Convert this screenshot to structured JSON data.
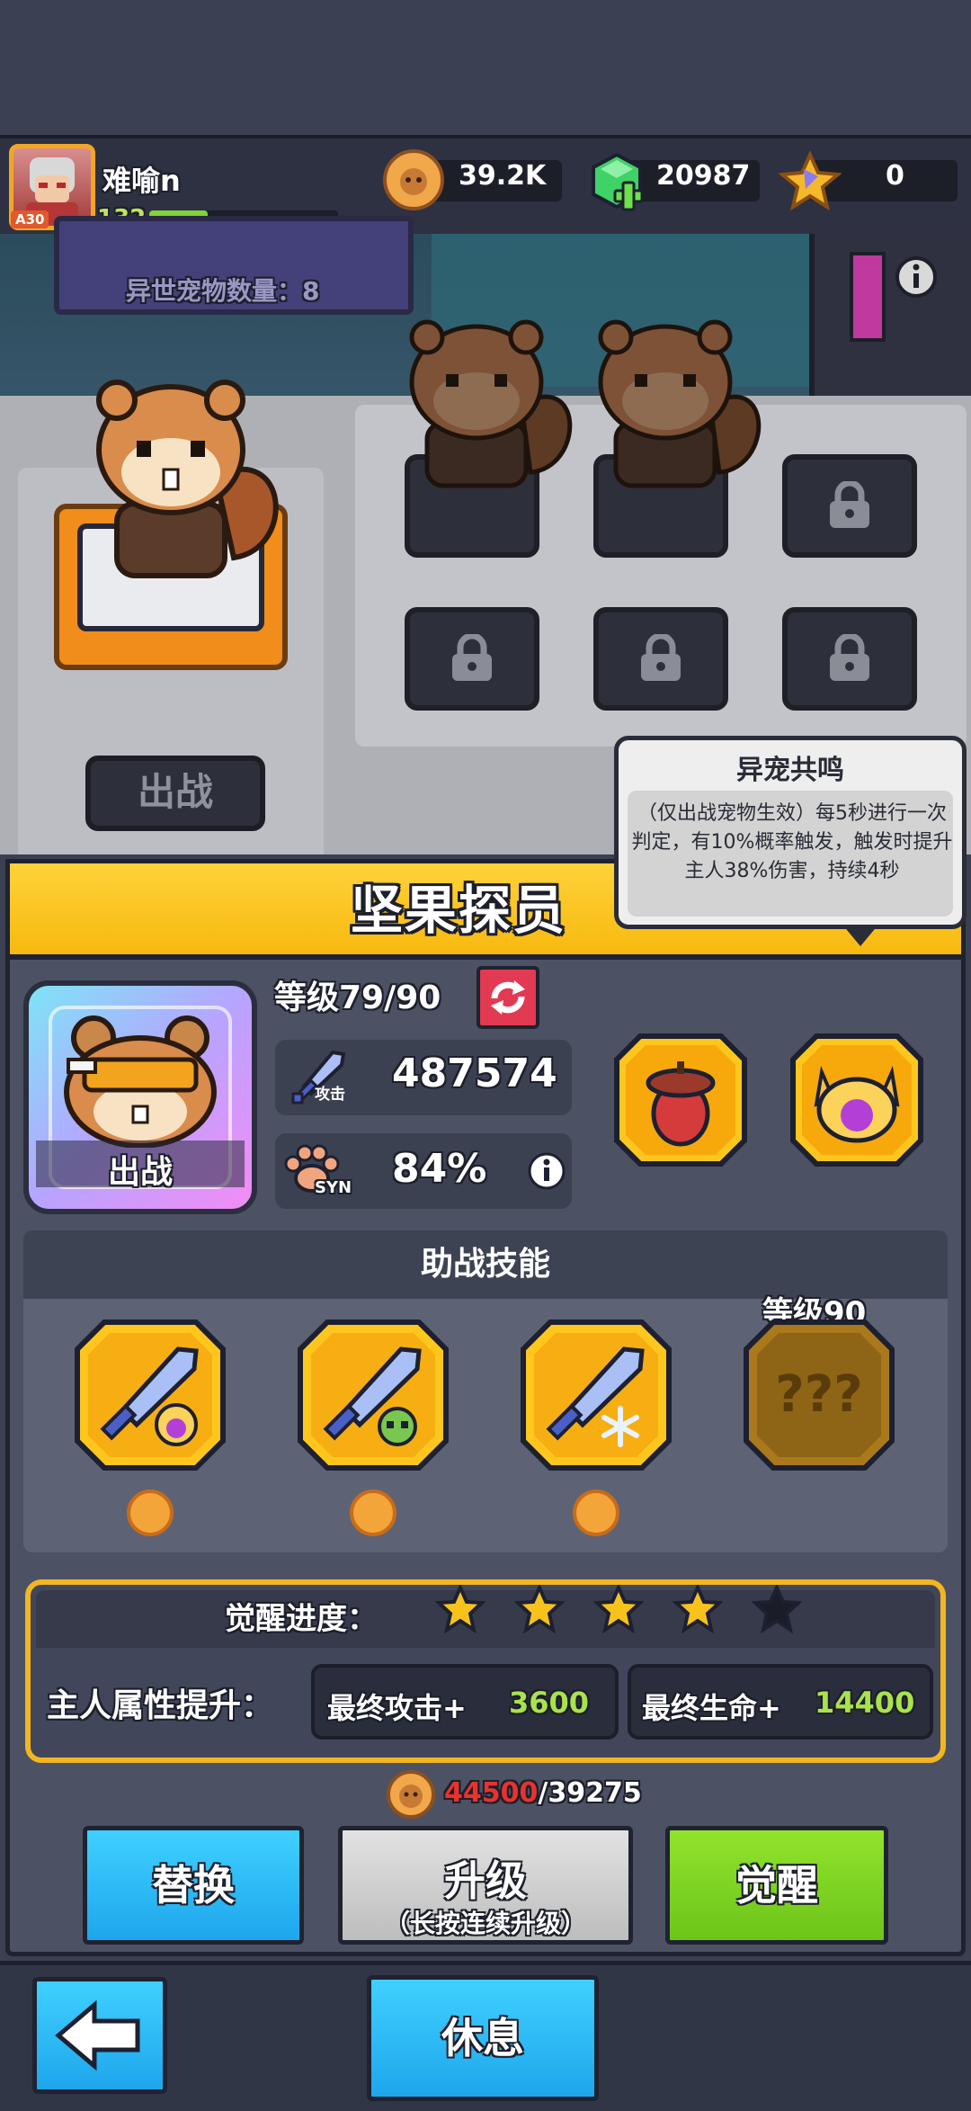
{
  "player": {
    "name": "难喻n",
    "level": "132",
    "avatar_badge": "A30",
    "xp_fraction": 0.31
  },
  "resources": {
    "coins": "39.2K",
    "gems": "20987",
    "stars": "0"
  },
  "room": {
    "pet_count_label": "异世宠物数量：8",
    "deploy_tag": "出战"
  },
  "tooltip": {
    "title": "异宠共鸣",
    "text": "（仅出战宠物生效）每5秒进行一次判定，有10%概率触发，触发时提升主人38%伤害，持续4秒"
  },
  "pet": {
    "name": "坚果探员",
    "portrait_label": "出战",
    "level_text": "等级79/90",
    "attack_badge": "攻击",
    "attack_value": "487574",
    "syn_badge": "SYN",
    "syn_value": "84%"
  },
  "skills": {
    "header": "助战技能",
    "locked_level_label": "等级90",
    "locked_text": "???"
  },
  "awakening": {
    "progress_label": "觉醒进度：",
    "stars_filled": 4,
    "stars_total": 5,
    "owner_bonus_label": "主人属性提升：",
    "attack_bonus_label": "最终攻击+",
    "attack_bonus_value": "3600",
    "hp_bonus_label": "最终生命+",
    "hp_bonus_value": "14400"
  },
  "cost": {
    "required": "44500",
    "owned": "/39275"
  },
  "buttons": {
    "replace": "替换",
    "upgrade": "升级",
    "upgrade_hint": "（长按连续升级）",
    "awaken": "觉醒",
    "rest": "休息"
  },
  "colors": {
    "banner_yellow": "#ffd23a",
    "blue_button": "#21b8f3",
    "green_button": "#7ed321",
    "gray_button": "#c9c9c9",
    "cost_red": "#e8322d",
    "bonus_green": "#a9e34b"
  },
  "icons": [
    "coin-icon",
    "gem-plus-icon",
    "star-badge-icon",
    "info-icon",
    "lock-icon",
    "sword-icon",
    "paw-icon",
    "refresh-icon",
    "acorn-icon",
    "cat-face-icon",
    "back-arrow-icon"
  ]
}
